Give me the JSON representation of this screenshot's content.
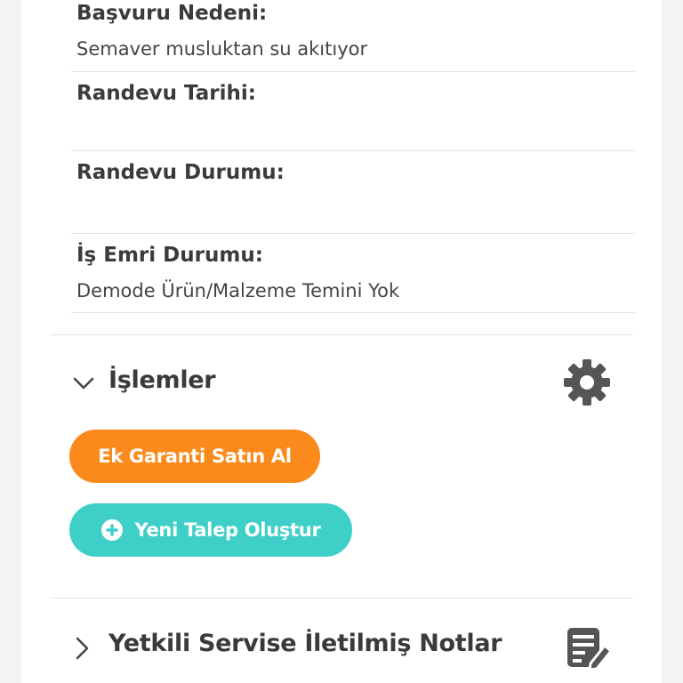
{
  "fields": [
    {
      "label": "Başvuru Nedeni:",
      "value": "Semaver musluktan su akıtıyor"
    },
    {
      "label": "Randevu Tarihi:",
      "value": ""
    },
    {
      "label": "Randevu Durumu:",
      "value": ""
    },
    {
      "label": "İş Emri Durumu:",
      "value": "Demode Ürün/Malzeme Temini Yok"
    }
  ],
  "actions": {
    "title": "İşlemler",
    "extra_warranty_label": "Ek Garanti Satın Al",
    "new_request_label": "Yeni Talep Oluştur"
  },
  "notes": {
    "title": "Yetkili Servise İletilmiş Notlar"
  },
  "colors": {
    "orange": "#fb8a1c",
    "teal": "#3ecfc8",
    "text_dark": "#3a3a3a",
    "icon_gray": "#555555"
  }
}
